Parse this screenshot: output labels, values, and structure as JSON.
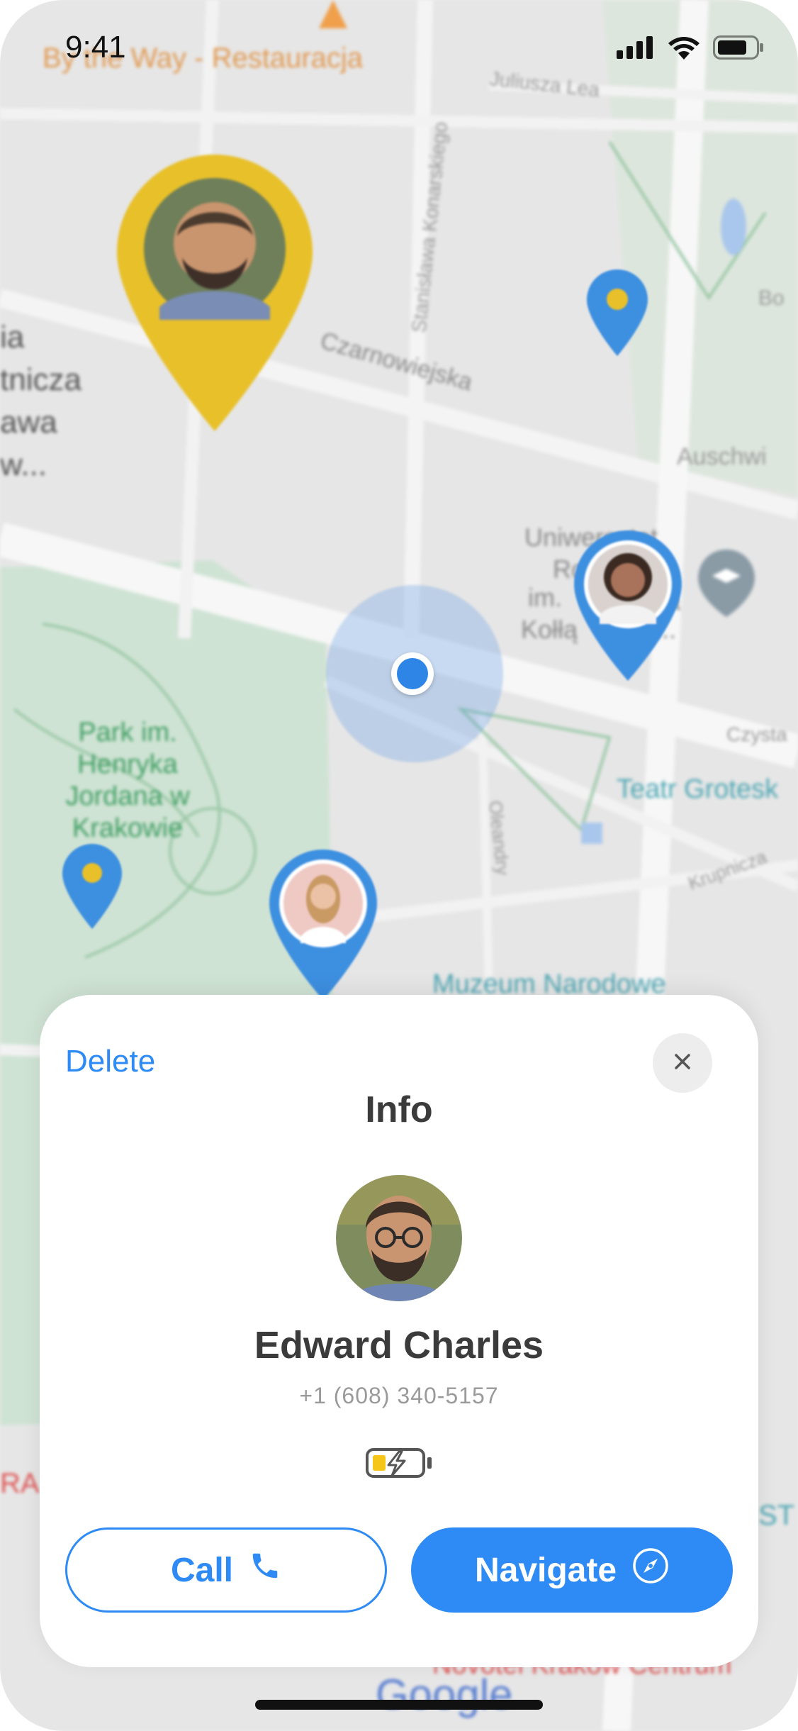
{
  "status_bar": {
    "time": "9:41"
  },
  "map": {
    "labels": {
      "restaurant": "By the Way - Restauracja",
      "street_juliusza": "Juliusza Lea",
      "street_konarskiego": "Stanisława Konarskiego",
      "street_czarnowiejska": "Czarnowiejska",
      "street_bo": "Bo",
      "auschwitz": "Auschwi",
      "left_1": "ia",
      "left_2": "tnicza",
      "left_3": "awa",
      "left_4": "w...",
      "university_1": "Uniwersytet",
      "university_2": "Ro",
      "university_3": "im.",
      "university_4": "Kołłą",
      "university_5": "w...",
      "park_1": "Park im.",
      "park_2": "Henryka",
      "park_3": "Jordana w",
      "park_4": "Krakowie",
      "czysta": "Czysta",
      "teatr": "Teatr Grotesk",
      "krupnicza": "Krupnicza",
      "oleandry": "Oleandry",
      "muzeum": "Muzeum Narodowe",
      "novotel": "Novotel Kraków Centrum",
      "google": "Google",
      "ra": "RA",
      "st": "ST",
      "a_s": "a"
    }
  },
  "sheet": {
    "delete_label": "Delete",
    "title": "Info",
    "contact_name": "Edward Charles",
    "contact_phone": "+1 (608) 340-5157",
    "call_label": "Call",
    "navigate_label": "Navigate"
  },
  "colors": {
    "accent": "#2E8BF5",
    "pin_yellow": "#E8C02A",
    "pin_blue": "#3D8FE0",
    "battery_level": "#F5C518"
  },
  "icons": [
    "signal-icon",
    "wifi-icon",
    "battery-icon",
    "close-icon",
    "phone-icon",
    "compass-icon",
    "charging-battery-icon",
    "graduation-cap-icon",
    "restaurant-icon"
  ]
}
